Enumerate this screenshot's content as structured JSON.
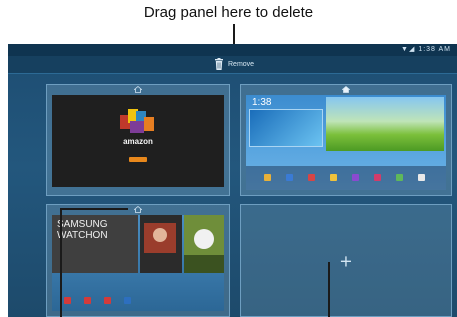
{
  "callouts": {
    "top": "Drag panel here to delete"
  },
  "status_bar": {
    "time": "1:38 AM"
  },
  "remove_bar": {
    "label": "Remove",
    "icon": "trash-icon"
  },
  "panels": [
    {
      "id": "amazon",
      "brand": "amazon"
    },
    {
      "id": "home",
      "clock": "1:38"
    },
    {
      "id": "watchon",
      "title_line1": "SAMSUNG",
      "title_line2": "WATCHON"
    },
    {
      "id": "empty",
      "icon": "plus-icon"
    }
  ],
  "colors": {
    "background": "#23577d",
    "panel_border": "#6e9ec0",
    "accent_orange": "#e8881c"
  }
}
